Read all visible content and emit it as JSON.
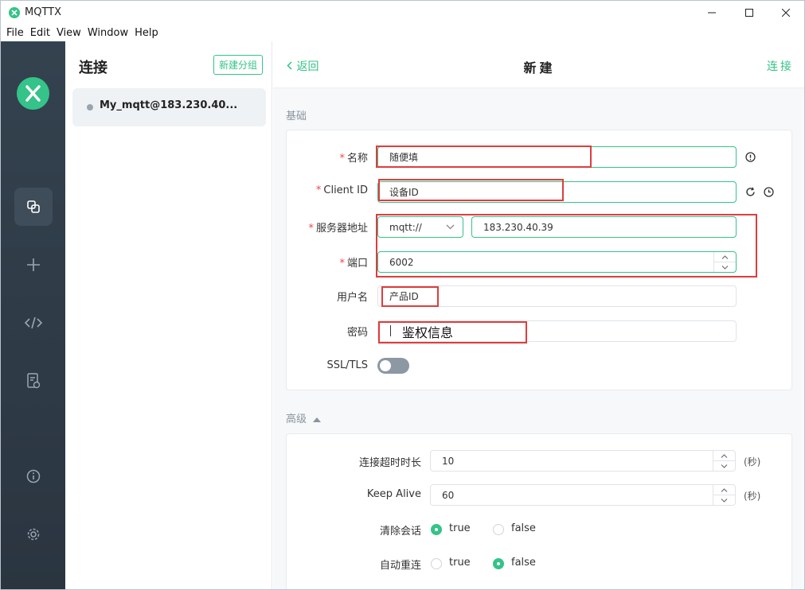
{
  "window": {
    "title": "MQTTX"
  },
  "menu": [
    "File",
    "Edit",
    "View",
    "Window",
    "Help"
  ],
  "rail": {
    "icons": [
      "connections-icon",
      "plus-icon",
      "code-icon",
      "log-icon",
      "info-icon",
      "settings-icon"
    ]
  },
  "connections": {
    "title": "连接",
    "new_group": "新建分组",
    "items": [
      {
        "name": "My_mqtt@183.230.40..."
      }
    ]
  },
  "header": {
    "back": "返回",
    "title": "新建",
    "connect": "连接"
  },
  "basic": {
    "section": "基础",
    "name": {
      "label": "名称",
      "value": "随便填"
    },
    "client_id": {
      "label": "Client ID",
      "value": "设备ID"
    },
    "host": {
      "label": "服务器地址",
      "protocol": "mqtt://",
      "value": "183.230.40.39"
    },
    "port": {
      "label": "端口",
      "value": "6002"
    },
    "username": {
      "label": "用户名",
      "value": "产品ID"
    },
    "password": {
      "label": "密码",
      "value": "鉴权信息"
    },
    "ssl": {
      "label": "SSL/TLS",
      "enabled": false
    }
  },
  "advanced": {
    "section": "高级",
    "timeout": {
      "label": "连接超时时长",
      "value": "10",
      "unit": "(秒)"
    },
    "keepalive": {
      "label": "Keep Alive",
      "value": "60",
      "unit": "(秒)"
    },
    "clean_session": {
      "label": "清除会话",
      "true_label": "true",
      "false_label": "false",
      "selected": "true"
    },
    "auto_reconnect": {
      "label": "自动重连",
      "true_label": "true",
      "false_label": "false",
      "selected": "false"
    }
  },
  "colors": {
    "accent": "#34c388",
    "rail": "#2f3b47",
    "annotation": "#e03c3c"
  }
}
